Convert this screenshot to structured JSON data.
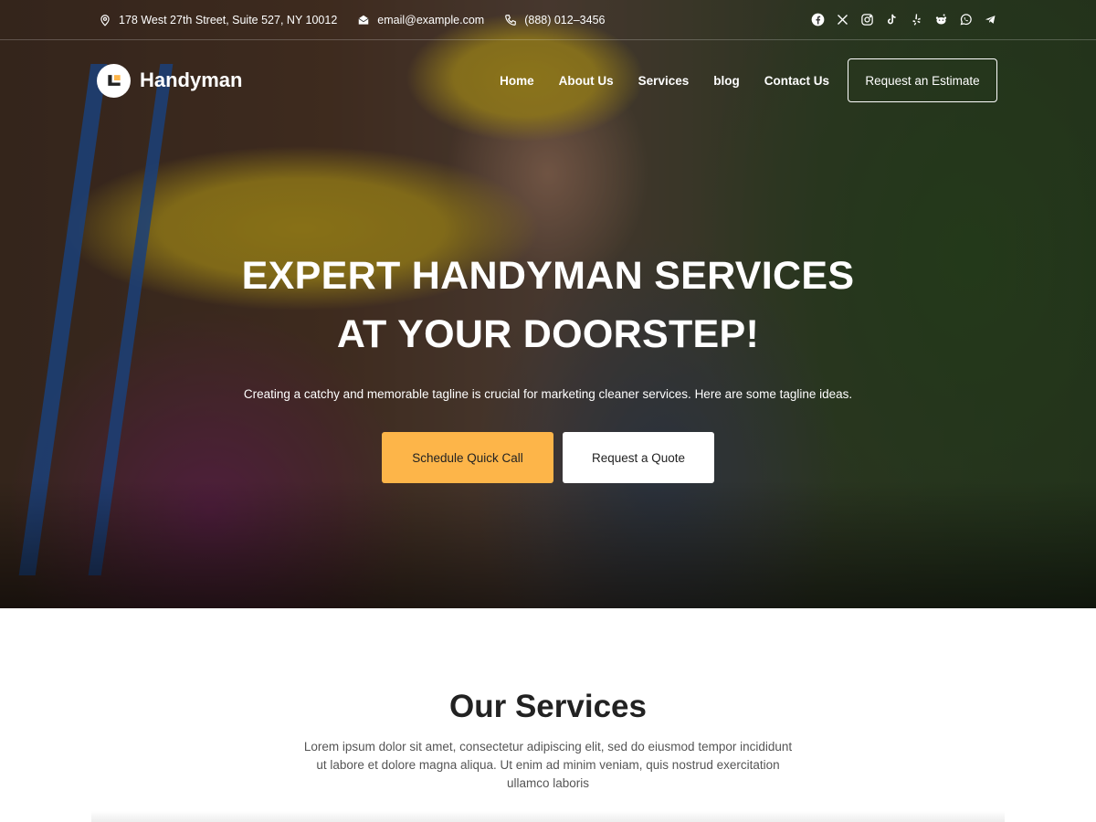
{
  "topbar": {
    "address": "178 West 27th Street, Suite 527, NY 10012",
    "email": "email@example.com",
    "phone": "(888) 012–3456",
    "socials": [
      "facebook-icon",
      "x-icon",
      "instagram-icon",
      "tiktok-icon",
      "yelp-icon",
      "reddit-icon",
      "whatsapp-icon",
      "telegram-icon"
    ]
  },
  "navbar": {
    "logo_text": "Handyman",
    "links": [
      "Home",
      "About Us",
      "Services",
      "blog",
      "Contact Us"
    ],
    "cta_label": "Request an Estimate"
  },
  "hero": {
    "title_line1": "EXPERT HANDYMAN SERVICES",
    "title_line2": "AT YOUR DOORSTEP!",
    "subtitle": "Creating a catchy and memorable tagline is crucial for marketing cleaner services. Here are some tagline ideas.",
    "primary_button": "Schedule Quick Call",
    "secondary_button": "Request a Quote"
  },
  "services": {
    "title": "Our Services",
    "description": "Lorem ipsum dolor sit amet, consectetur adipiscing elit, sed do eiusmod tempor incididunt ut labore et dolore magna aliqua. Ut enim ad minim veniam, quis nostrud exercitation ullamco laboris"
  },
  "colors": {
    "accent": "#fdb549",
    "text_dark": "#222222",
    "text_muted": "#555555"
  }
}
